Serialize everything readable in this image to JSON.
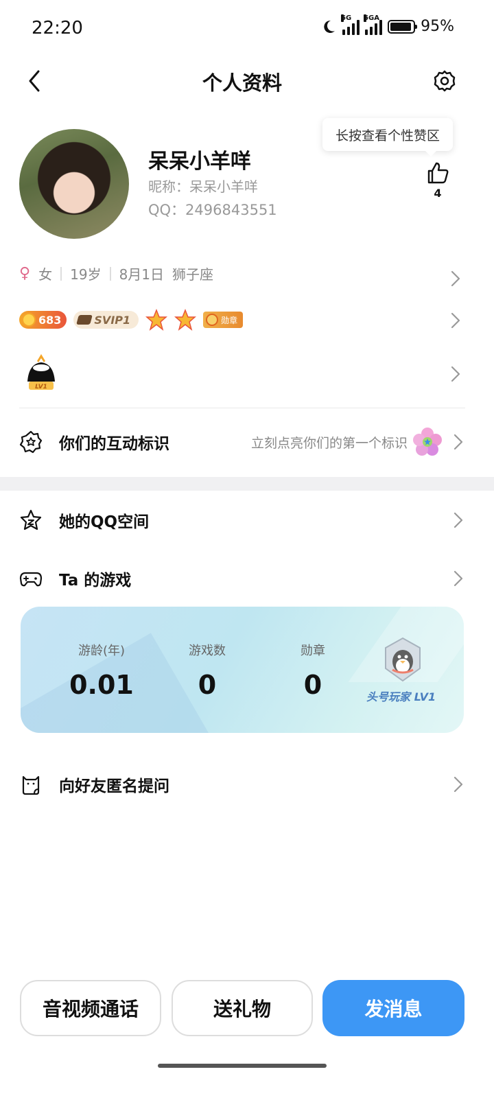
{
  "status_bar": {
    "time": "22:20",
    "network_1": "5G",
    "network_2": "5GA",
    "battery": "95%",
    "battery_level": 0.95
  },
  "nav": {
    "title": "个人资料",
    "back_icon": "chevron-left-icon",
    "settings_icon": "gear-icon"
  },
  "profile": {
    "display_name": "呆呆小羊咩",
    "nickname": "昵称：呆呆小羊咩",
    "qq": "QQ：2496843551",
    "tooltip": "长按查看个性赞区",
    "like_count": "4"
  },
  "info": {
    "gender": "女",
    "age": "19岁",
    "birthday": "8月1日",
    "zodiac": "狮子座"
  },
  "badges": {
    "level": "683",
    "svip": "SVIP1",
    "medal": "勋章"
  },
  "game_level_badge": "LV1",
  "menu": {
    "interaction": {
      "label": "你们的互动标识",
      "hint": "立刻点亮你们的第一个标识"
    },
    "qzone": {
      "label": "她的QQ空间"
    },
    "games": {
      "label": "Ta 的游戏"
    },
    "anon": {
      "label": "向好友匿名提问"
    }
  },
  "game_card": {
    "stats": [
      {
        "label": "游龄(年)",
        "value": "0.01"
      },
      {
        "label": "游戏数",
        "value": "0"
      },
      {
        "label": "勋章",
        "value": "0"
      }
    ],
    "rank_label": "头号玩家 LV1"
  },
  "buttons": {
    "call": "音视频通话",
    "gift": "送礼物",
    "message": "发消息"
  },
  "colors": {
    "primary": "#3d97f5",
    "female": "#e06a8c",
    "muted_text": "#888888"
  }
}
